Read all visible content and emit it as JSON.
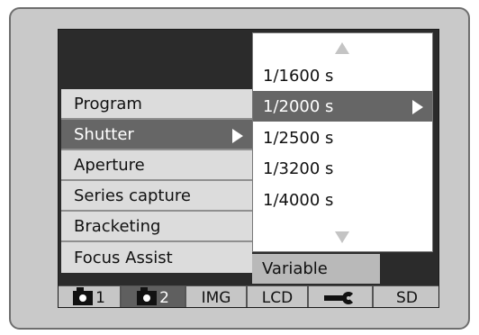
{
  "menu": {
    "items": [
      {
        "label": "Program"
      },
      {
        "label": "Shutter",
        "selected": true
      },
      {
        "label": "Aperture"
      },
      {
        "label": "Series capture"
      },
      {
        "label": "Bracketing"
      },
      {
        "label": "Focus Assist"
      }
    ]
  },
  "shutter_list": {
    "options": [
      "1/1600 s",
      "1/2000 s",
      "1/2500 s",
      "1/3200 s",
      "1/4000 s"
    ],
    "selected": "1/2000 s"
  },
  "focus_assist_value": "Variable",
  "tabs": {
    "tab1_number": "1",
    "tab2_number": "2",
    "img": "IMG",
    "lcd": "LCD",
    "sd": "SD",
    "tab1_icon": "camera-icon",
    "tab2_icon": "camera-icon",
    "setup_icon": "wrench-icon"
  }
}
